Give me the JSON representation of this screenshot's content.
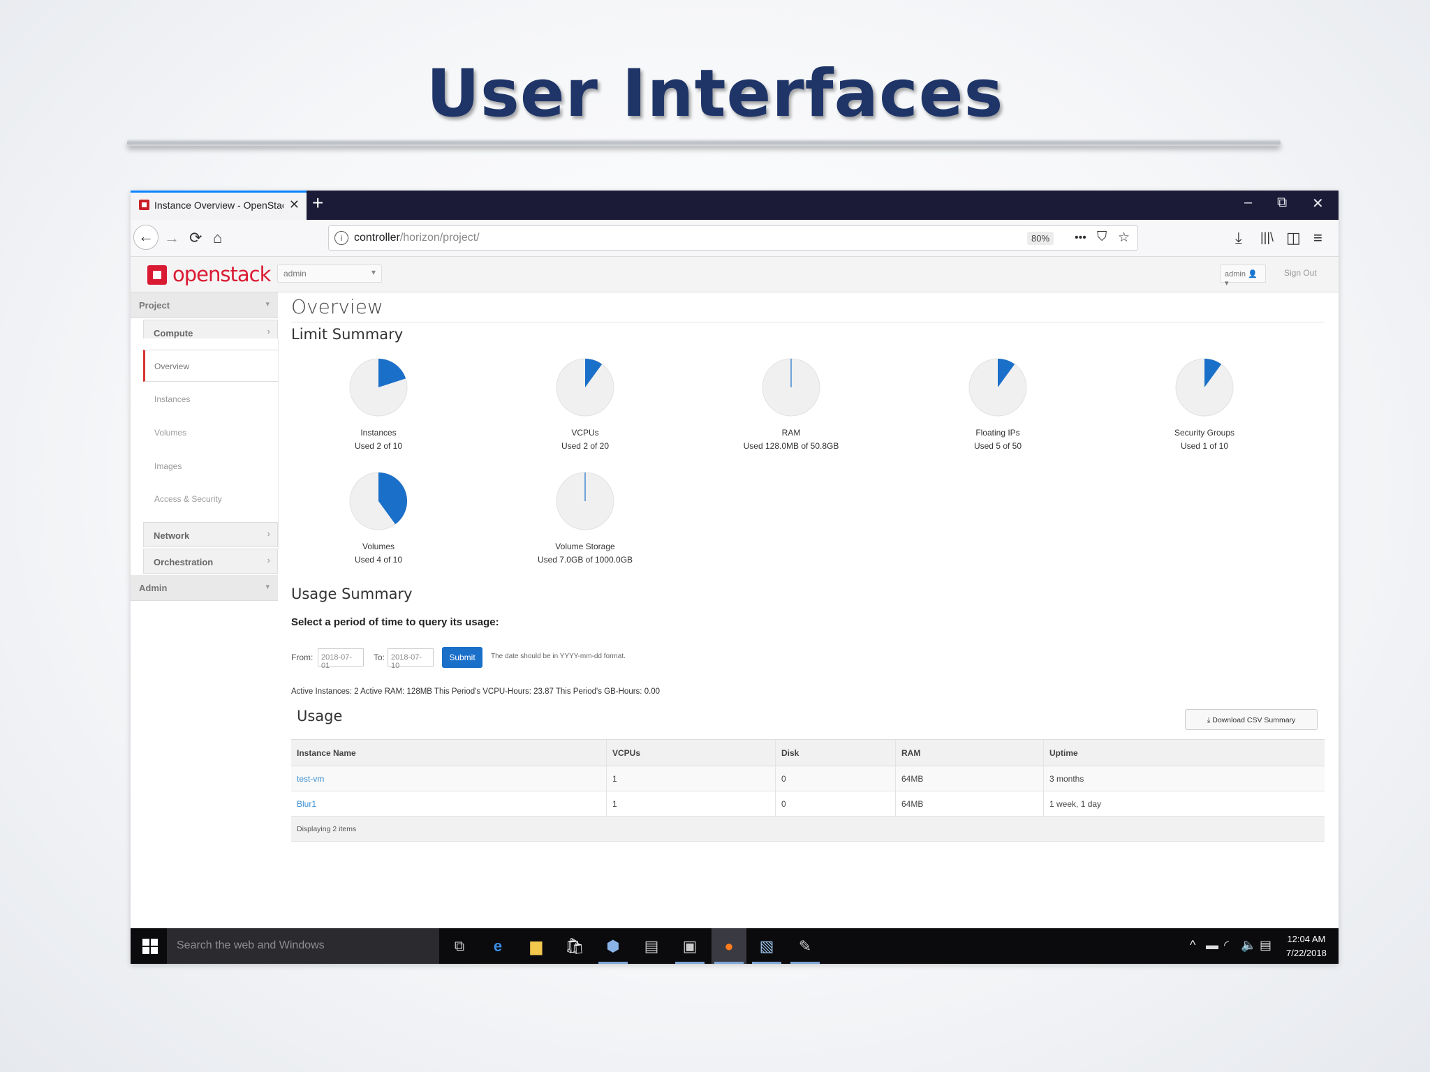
{
  "slide": {
    "title": "User Interfaces"
  },
  "browser": {
    "tab_title": "Instance Overview - OpenStack",
    "tab_close": "✕",
    "new_tab": "+",
    "window_minimize": "–",
    "window_restore": "⧉",
    "window_close": "✕",
    "url_host": "controller",
    "url_path": "/horizon/project/",
    "zoom": "80%",
    "more": "•••"
  },
  "openstack": {
    "logo_text": "openstack",
    "project_select": "admin",
    "user_menu": "admin",
    "sign_out": "Sign Out"
  },
  "sidebar": {
    "project": "Project",
    "compute": "Compute",
    "items": [
      "Overview",
      "Instances",
      "Volumes",
      "Images",
      "Access & Security"
    ],
    "network": "Network",
    "orchestration": "Orchestration",
    "admin": "Admin"
  },
  "main": {
    "heading": "Overview",
    "limit_summary": "Limit Summary",
    "usage_summary": "Usage Summary",
    "query_prompt": "Select a period of time to query its usage:",
    "from_label": "From:",
    "from_value": "2018-07-01",
    "to_label": "To:",
    "to_value": "2018-07-10",
    "submit": "Submit",
    "date_hint": "The date should be in YYYY-mm-dd format.",
    "active_summary": "Active Instances: 2 Active RAM: 128MB This Period's VCPU-Hours: 23.87 This Period's GB-Hours: 0.00",
    "usage_heading": "Usage",
    "csv_button": "Download CSV Summary"
  },
  "limits": [
    {
      "name": "Instances",
      "text": "Used 2 of 10",
      "used": 2,
      "total": 10
    },
    {
      "name": "VCPUs",
      "text": "Used 2 of 20",
      "used": 2,
      "total": 20
    },
    {
      "name": "RAM",
      "text": "Used 128.0MB of 50.8GB",
      "used": 128,
      "total": 52019
    },
    {
      "name": "Floating IPs",
      "text": "Used 5 of 50",
      "used": 5,
      "total": 50
    },
    {
      "name": "Security Groups",
      "text": "Used 1 of 10",
      "used": 1,
      "total": 10
    },
    {
      "name": "Volumes",
      "text": "Used 4 of 10",
      "used": 4,
      "total": 10
    },
    {
      "name": "Volume Storage",
      "text": "Used 7.0GB of 1000.0GB",
      "used": 7,
      "total": 1000
    }
  ],
  "usage_table": {
    "headers": [
      "Instance Name",
      "VCPUs",
      "Disk",
      "RAM",
      "Uptime"
    ],
    "rows": [
      [
        "test-vm",
        "1",
        "0",
        "64MB",
        "3 months"
      ],
      [
        "Blur1",
        "1",
        "0",
        "64MB",
        "1 week, 1 day"
      ]
    ],
    "footer": "Displaying 2 items"
  },
  "taskbar": {
    "search_placeholder": "Search the web and Windows",
    "time": "12:04 AM",
    "date": "7/22/2018"
  },
  "colors": {
    "pie_used": "#1a6fc9",
    "pie_free": "#f0f0f0",
    "title": "#1f3568",
    "brand_red": "#da1a32"
  }
}
